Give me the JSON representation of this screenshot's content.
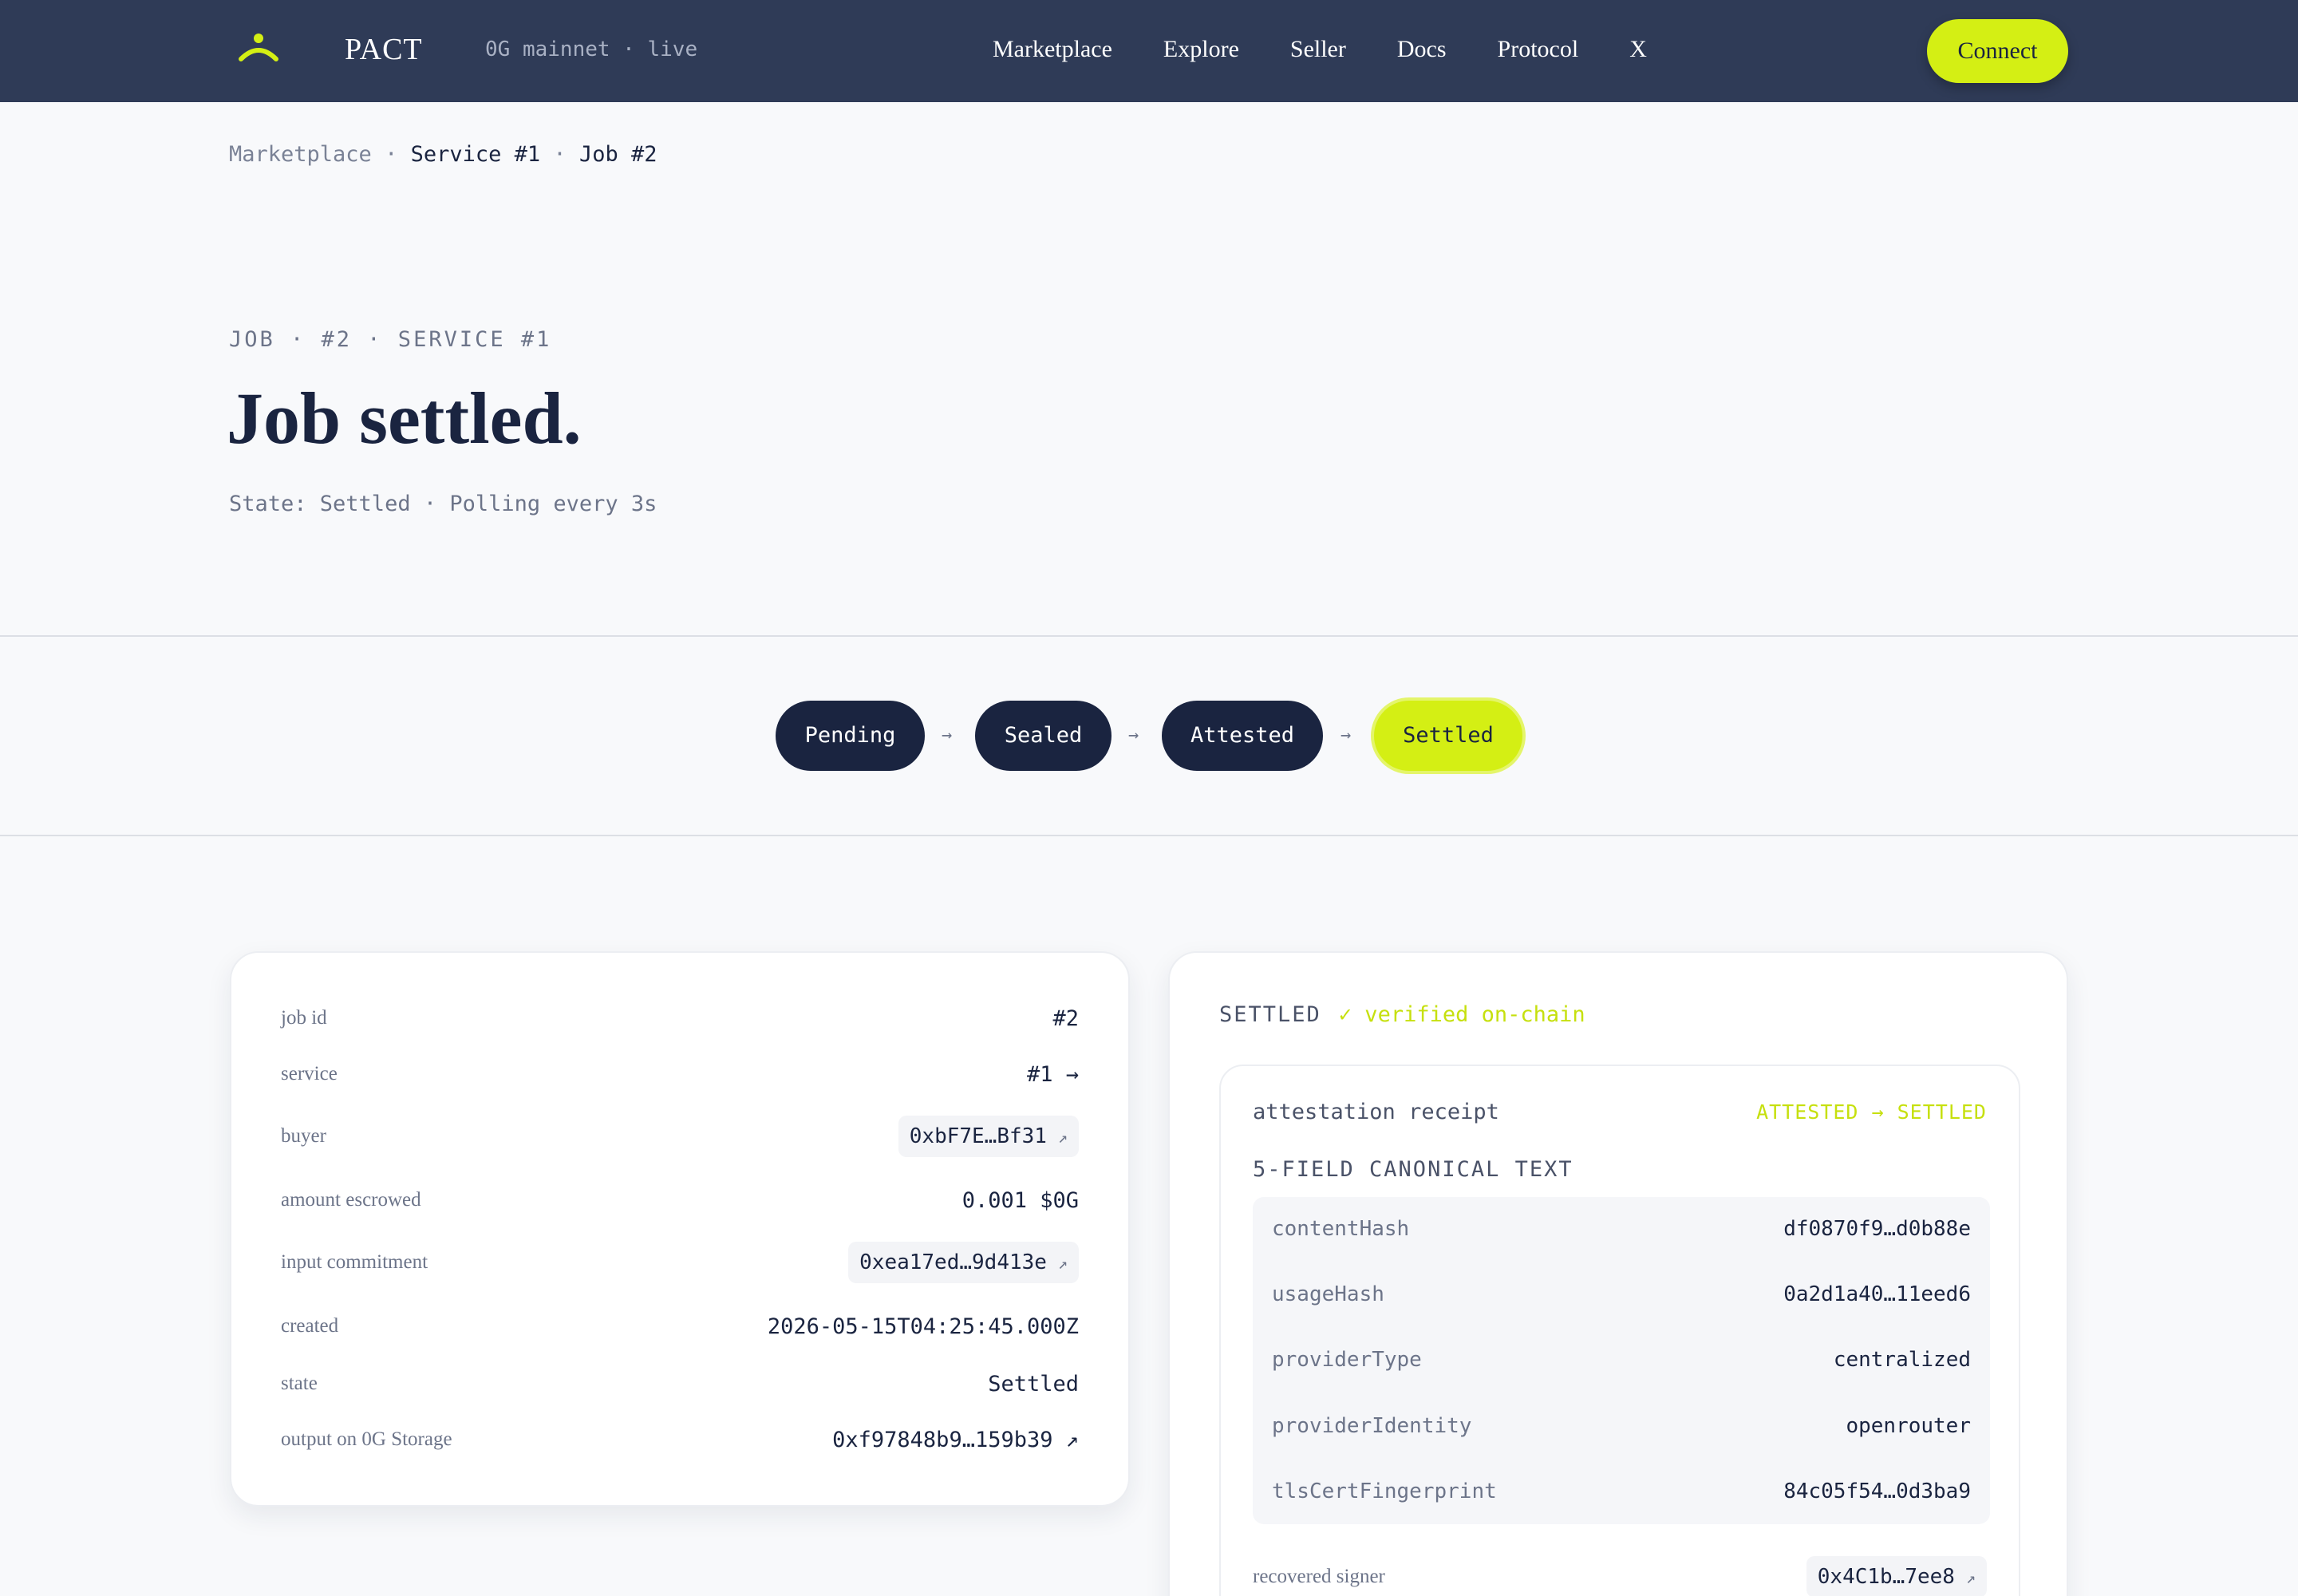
{
  "nav": {
    "brand": "PACT",
    "network": "0G mainnet · live",
    "links": [
      "Marketplace",
      "Explore",
      "Seller",
      "Docs",
      "Protocol",
      "X"
    ],
    "connect": "Connect"
  },
  "breadcrumb": {
    "root": "Marketplace",
    "sep": "·",
    "service": "Service #1",
    "job": "Job #2"
  },
  "hero": {
    "eyebrow": "JOB · #2 · SERVICE #1",
    "title": "Job settled.",
    "state": "State: Settled · Polling every 3s"
  },
  "pipeline": {
    "steps": [
      "Pending",
      "Sealed",
      "Attested",
      "Settled"
    ],
    "arrow": "→",
    "active": "Settled"
  },
  "job": {
    "rows": [
      {
        "label": "job id",
        "value": "#2"
      },
      {
        "label": "service",
        "value": "#1 →"
      },
      {
        "label": "buyer",
        "value": "0xbF7E…Bf31",
        "ext": "↗"
      },
      {
        "label": "amount escrowed",
        "value": "0.001 $0G"
      },
      {
        "label": "input commitment",
        "value": "0xea17ed…9d413e",
        "ext": "↗"
      },
      {
        "label": "created",
        "value": "2026-05-15T04:25:45.000Z"
      },
      {
        "label": "state",
        "value": "Settled"
      },
      {
        "label": "output on 0G Storage",
        "value": "0xf97848b9…159b39 ↗"
      }
    ]
  },
  "settlement": {
    "status": "SETTLED",
    "verified": "✓ verified on-chain",
    "receipt_title": "attestation receipt",
    "receipt_state": "ATTESTED → SETTLED",
    "canonical_title": "5-FIELD CANONICAL TEXT",
    "fields": [
      {
        "key": "contentHash",
        "value": "df0870f9…d0b88e"
      },
      {
        "key": "usageHash",
        "value": "0a2d1a40…11eed6"
      },
      {
        "key": "providerType",
        "value": "centralized"
      },
      {
        "key": "providerIdentity",
        "value": "openrouter"
      },
      {
        "key": "tlsCertFingerprint",
        "value": "84c05f54…0d3ba9"
      }
    ],
    "signer_label": "recovered signer",
    "signer_value": "0x4C1b…7ee8",
    "signer_ext": "↗"
  },
  "colors": {
    "nav_bg": "#2f3b57",
    "accent": "#d4ef14",
    "navy": "#1a2440"
  },
  "icons": {
    "logo": "pact-logo-icon",
    "external": "external-link-icon"
  }
}
